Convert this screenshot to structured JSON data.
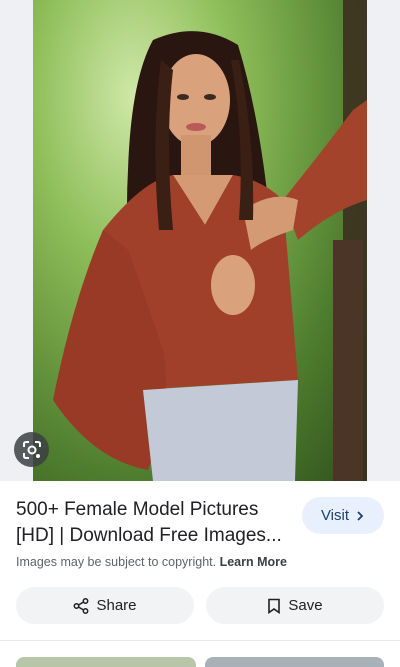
{
  "result": {
    "title_line1": "500+ Female Model Pictures",
    "title_line2": "[HD] | Download Free Images...",
    "visit_label": "Visit",
    "copyright_text": "Images may be subject to copyright.",
    "learn_more": "Learn More"
  },
  "actions": {
    "share_label": "Share",
    "save_label": "Save"
  },
  "icons": {
    "lens": "lens-search-icon",
    "chevron": "chevron-right-icon",
    "share": "share-icon",
    "save": "bookmark-icon"
  },
  "colors": {
    "visit_bg": "#e8f0fe",
    "action_bg": "#f1f3f4",
    "text_primary": "#202124",
    "text_secondary": "#5f6368"
  }
}
